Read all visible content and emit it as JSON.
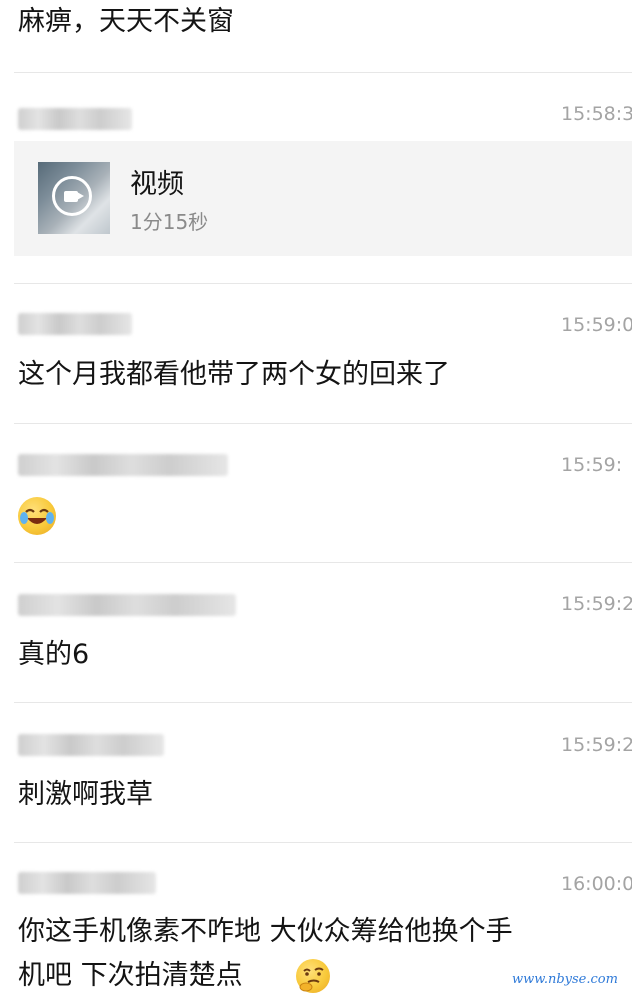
{
  "messages": [
    {
      "text": "麻痹，天天不关窗"
    },
    {
      "time": "15:58:3",
      "video": {
        "title": "视频",
        "duration": "1分15秒"
      }
    },
    {
      "time": "15:59:0",
      "text": "这个月我都看他带了两个女的回来了"
    },
    {
      "time": "15:59:",
      "emoji": "laughing-crying-emoji"
    },
    {
      "time": "15:59:2",
      "text": "真的6"
    },
    {
      "time": "15:59:2",
      "text": "刺激啊我草"
    },
    {
      "time": "16:00:0",
      "text_line1": "你这手机像素不咋地 大伙众筹给他换个手",
      "text_line2": "机吧 下次拍清楚点",
      "emoji": "thinking-emoji"
    }
  ],
  "watermark": "www.nbyse.com",
  "colors": {
    "time": "#a4a4a4",
    "card_bg": "#f4f4f4",
    "divider": "#e7e7e7",
    "watermark": "#2f7ad8"
  }
}
